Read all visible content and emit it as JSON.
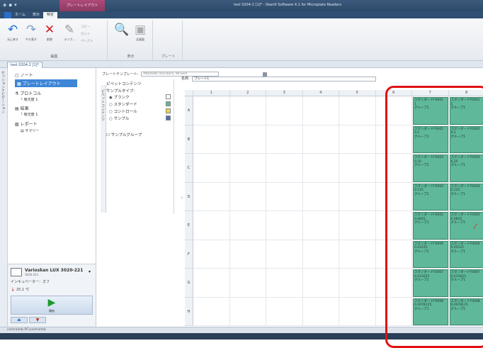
{
  "title_bar": {
    "contextual_tab": "プレートレイアウト",
    "window_title": "test 0204-2 [1]* - SkanIt Software 4.1 for Microplate Readers"
  },
  "ribbon_tabs": [
    "",
    "ホーム",
    "表示",
    "特定"
  ],
  "ribbon": {
    "edit_group": {
      "label": "編集",
      "undo": "元に戻す",
      "redo": "やり直す",
      "delete": "削除",
      "buttons_small": [
        "コピー",
        "カット",
        "ペースト",
        "ランプ..."
      ]
    },
    "display_group": {
      "label": "表示",
      "preview": "プレビュー",
      "fullscreen": "全画面"
    },
    "plate_group": {
      "label": "プレート"
    }
  },
  "doc_tab": "test 0204-2 [1]*",
  "left_strip_label": "セッションナビゲーション",
  "nav": {
    "items": [
      {
        "label": "ノート",
        "indent": 0,
        "selected": false,
        "icon": "note-icon"
      },
      {
        "label": "プレートレイアウト",
        "indent": 0,
        "selected": true,
        "icon": "plate-icon"
      },
      {
        "label": "プロトコル",
        "indent": 0,
        "selected": false,
        "icon": "protocol-icon"
      },
      {
        "label": "吸光度 1",
        "indent": 1,
        "selected": false,
        "icon": "measure-icon"
      },
      {
        "label": "結果",
        "indent": 0,
        "selected": false,
        "icon": "results-icon"
      },
      {
        "label": "吸光度 1",
        "indent": 1,
        "selected": false,
        "icon": "measure-icon"
      },
      {
        "label": "レポート",
        "indent": 0,
        "selected": false,
        "icon": "report-icon"
      },
      {
        "label": "サマリー",
        "indent": 1,
        "selected": false,
        "icon": "summary-icon"
      }
    ]
  },
  "instrument": {
    "name": "Varioskan LUX 3020-221",
    "sub": "3020-221",
    "incubator": "インキュベーター：オフ",
    "temperature": "25.1 ℃",
    "start_label": "開始"
  },
  "template_label": "プレートテンプレート:",
  "template_value": "ANSI/SBS Standard, 96-well",
  "name_label": "名称:",
  "name_value": "プレート1",
  "pipette": {
    "title": "ピペットコンテンツ",
    "sample_type_label": "サンプルタイプ:",
    "options": [
      {
        "label": "ブランク",
        "checked": true,
        "color": "#ffffff"
      },
      {
        "label": "スタンダード",
        "checked": false,
        "color": "#5fb89a"
      },
      {
        "label": "コントロール",
        "checked": false,
        "color": "#e8d84a"
      },
      {
        "label": "サンプル",
        "checked": false,
        "color": "#4a6fb0"
      }
    ],
    "group_label": "サンプルグループ"
  },
  "vertical_tab_label": "ピペットコンテンツ",
  "plate": {
    "columns": [
      "1",
      "2",
      "3",
      "4",
      "5",
      "6",
      "7",
      "8"
    ],
    "rows": [
      "A",
      "B",
      "C",
      "D",
      "E",
      "F",
      "G",
      "H"
    ],
    "wells": [
      {
        "row": 0,
        "col": 6,
        "name": "スタンダードF0001",
        "conc": "1",
        "group": "グループ1"
      },
      {
        "row": 0,
        "col": 7,
        "name": "スタンダードF0001",
        "conc": "1",
        "group": "グループ1"
      },
      {
        "row": 1,
        "col": 6,
        "name": "スタンダードF0002",
        "conc": "0.5",
        "group": "グループ1"
      },
      {
        "row": 1,
        "col": 7,
        "name": "スタンダードF0002",
        "conc": "0.5",
        "group": "グループ1"
      },
      {
        "row": 2,
        "col": 6,
        "name": "スタンダードF0003",
        "conc": "0.25",
        "group": "グループ1"
      },
      {
        "row": 2,
        "col": 7,
        "name": "スタンダードF0003",
        "conc": "0.25",
        "group": "グループ1"
      },
      {
        "row": 3,
        "col": 6,
        "name": "スタンダードF0004",
        "conc": "0.125",
        "group": "グループ1"
      },
      {
        "row": 3,
        "col": 7,
        "name": "スタンダードF0004",
        "conc": "0.125",
        "group": "グループ1"
      },
      {
        "row": 4,
        "col": 6,
        "name": "スタンダードF0005",
        "conc": "0.0625",
        "group": "グループ1"
      },
      {
        "row": 4,
        "col": 7,
        "name": "スタンダードF0005",
        "conc": "0.0625",
        "group": "グループ1"
      },
      {
        "row": 5,
        "col": 6,
        "name": "スタンダードF0006",
        "conc": "0.03125",
        "group": "グループ1"
      },
      {
        "row": 5,
        "col": 7,
        "name": "スタンダードF0006",
        "conc": "0.03125",
        "group": "グループ1"
      },
      {
        "row": 6,
        "col": 6,
        "name": "スタンダードF0007",
        "conc": "0.015625",
        "group": "グループ1"
      },
      {
        "row": 6,
        "col": 7,
        "name": "スタンダードF0007",
        "conc": "0.015625",
        "group": "グループ1"
      },
      {
        "row": 7,
        "col": 6,
        "name": "スタンダードF0008",
        "conc": "0.0078125",
        "group": "グループ1"
      },
      {
        "row": 7,
        "col": 7,
        "name": "スタンダードF0008",
        "conc": "0.0078125",
        "group": "グループ1"
      }
    ]
  },
  "status_bar": "centralmb-PC\\centralmb",
  "colors": {
    "standard_well": "#5fb89a",
    "annotation_red": "#e01010",
    "selection_blue": "#3e86d6"
  }
}
